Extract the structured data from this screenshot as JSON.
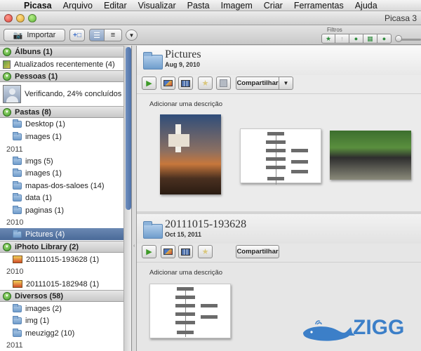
{
  "menubar": {
    "app_name": "Picasa",
    "items": [
      "Arquivo",
      "Editar",
      "Visualizar",
      "Pasta",
      "Imagem",
      "Criar",
      "Ferramentas",
      "Ajuda"
    ]
  },
  "window": {
    "title": "Picasa 3"
  },
  "toolbar": {
    "import_label": "Importar",
    "filters_label": "Filtros"
  },
  "sidebar": {
    "albums_header": "Álbuns (1)",
    "albums_item": "Atualizados recentemente (4)",
    "people_header": "Pessoas (1)",
    "people_status": "Verificando, 24% concluídos",
    "folders_header": "Pastas (8)",
    "folders": [
      "Desktop (1)",
      "images (1)"
    ],
    "year_2011": "2011",
    "folders_2011": [
      "imgs (5)",
      "images (1)",
      "mapas-dos-saloes (14)",
      "data (1)",
      "paginas (1)"
    ],
    "year_2010": "2010",
    "folders_2010": [
      "Pictures (4)"
    ],
    "iphoto_header": "iPhoto Library (2)",
    "iphoto_items": [
      "20111015-193628 (1)"
    ],
    "iphoto_year": "2010",
    "iphoto_items_2010": [
      "20111015-182948 (1)"
    ],
    "misc_header": "Diversos (58)",
    "misc_items": [
      "images (2)",
      "img (1)",
      "meuzigg2 (10)"
    ],
    "misc_year": "2011"
  },
  "main": {
    "album1": {
      "name": "Pictures",
      "date": "Aug 9, 2010",
      "share_label": "Compartilhar",
      "description_placeholder": "Adicionar uma descrição"
    },
    "album2": {
      "name": "20111015-193628",
      "date": "Oct 15, 2011",
      "share_label": "Compartilhar",
      "description_placeholder": "Adicionar uma descrição"
    }
  },
  "watermark": {
    "text": "ZIGG"
  }
}
